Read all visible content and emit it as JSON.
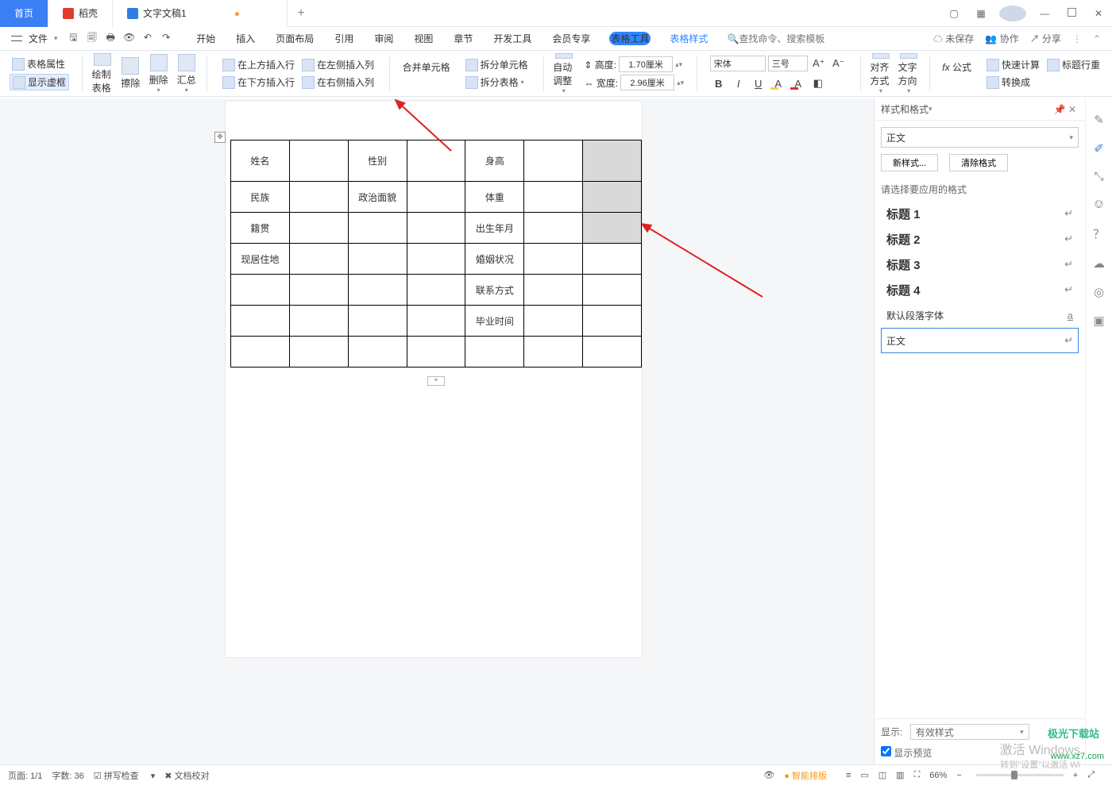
{
  "tabs": {
    "home": "首页",
    "shell": "稻壳",
    "doc": "文字文稿1",
    "plus": "+"
  },
  "menubar": {
    "file": "文件",
    "items": [
      "开始",
      "插入",
      "页面布局",
      "引用",
      "审阅",
      "视图",
      "章节",
      "开发工具",
      "会员专享"
    ],
    "table_tool": "表格工具",
    "table_style": "表格样式",
    "search_ph": "查找命令、搜索模板",
    "unsaved": "未保存",
    "coop": "协作",
    "share": "分享"
  },
  "ribbon": {
    "props": "表格属性",
    "vframe": "显示虚框",
    "draw": "绘制表格",
    "erase": "擦除",
    "delete": "删除",
    "summary": "汇总",
    "ins_above": "在上方插入行",
    "ins_below": "在下方插入行",
    "ins_left": "在左侧插入列",
    "ins_right": "在右侧插入列",
    "merge": "合并单元格",
    "split": "拆分单元格",
    "split_tbl": "拆分表格",
    "autofit": "自动调整",
    "height": "高度:",
    "height_v": "1.70厘米",
    "width": "宽度:",
    "width_v": "2.96厘米",
    "font": "宋体",
    "size": "三号",
    "align": "对齐方式",
    "textdir": "文字方向",
    "formula": "公式",
    "quickcalc": "快速计算",
    "titlerow": "标题行重",
    "convert": "转换成"
  },
  "table": {
    "r1": [
      "姓名",
      "",
      "性别",
      "",
      "身高",
      "",
      ""
    ],
    "r2": [
      "民族",
      "",
      "政治面貌",
      "",
      "体重",
      "",
      ""
    ],
    "r3": [
      "籍贯",
      "",
      "",
      "",
      "出生年月",
      "",
      ""
    ],
    "r4": [
      "现居住地",
      "",
      "",
      "",
      "婚姻状况",
      "",
      ""
    ],
    "r5": [
      "",
      "",
      "",
      "",
      "联系方式",
      "",
      ""
    ],
    "r6": [
      "",
      "",
      "",
      "",
      "毕业时间",
      "",
      ""
    ],
    "r7": [
      "",
      "",
      "",
      "",
      "",
      "",
      ""
    ]
  },
  "sidepanel": {
    "title": "样式和格式",
    "current": "正文",
    "new": "新样式...",
    "clear": "清除格式",
    "prompt": "请选择要应用的格式",
    "styles": [
      "标题 1",
      "标题 2",
      "标题 3",
      "标题 4"
    ],
    "default_font": "默认段落字体",
    "body": "正文",
    "show": "显示:",
    "show_v": "有效样式",
    "preview": "显示预览"
  },
  "status": {
    "page": "页面: 1/1",
    "words": "字数: 36",
    "spell": "拼写检查",
    "proof": "文档校对",
    "smart": "智能排版",
    "zoom": "66%"
  },
  "watermark": {
    "a": "激活 Windows",
    "b": "转到\"设置\"以激活 Wi",
    "c": "极光下载站",
    "d": "www.xz7.com"
  }
}
